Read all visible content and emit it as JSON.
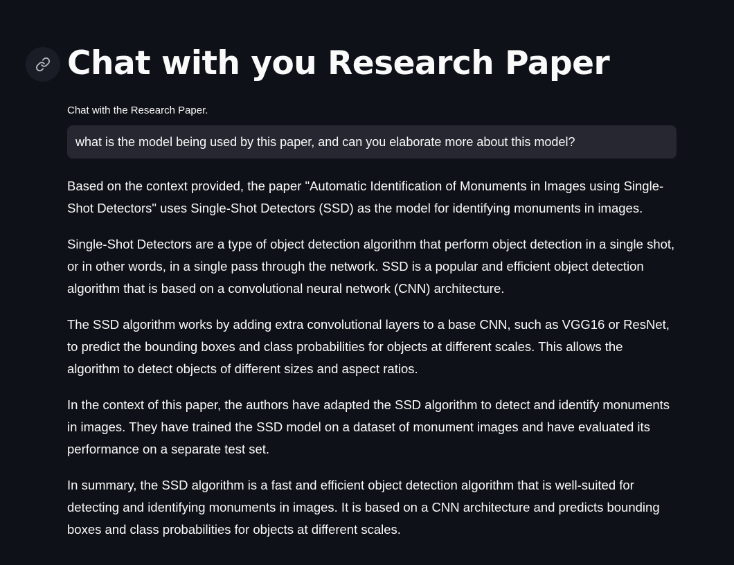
{
  "header": {
    "title": "Chat with you Research Paper",
    "anchor_icon": "link-icon"
  },
  "query": {
    "label": "Chat with the Research Paper.",
    "value": "what is the model being used by this paper, and can you elaborate more about this model?"
  },
  "answer": {
    "paragraphs": [
      "Based on the context provided, the paper \"Automatic Identification of Monuments in Images using Single-Shot Detectors\" uses Single-Shot Detectors (SSD) as the model for identifying monuments in images.",
      "Single-Shot Detectors are a type of object detection algorithm that perform object detection in a single shot, or in other words, in a single pass through the network. SSD is a popular and efficient object detection algorithm that is based on a convolutional neural network (CNN) architecture.",
      "The SSD algorithm works by adding extra convolutional layers to a base CNN, such as VGG16 or ResNet, to predict the bounding boxes and class probabilities for objects at different scales. This allows the algorithm to detect objects of different sizes and aspect ratios.",
      "In the context of this paper, the authors have adapted the SSD algorithm to detect and identify monuments in images. They have trained the SSD model on a dataset of monument images and have evaluated its performance on a separate test set.",
      "In summary, the SSD algorithm is a fast and efficient object detection algorithm that is well-suited for detecting and identifying monuments in images. It is based on a CNN architecture and predicts bounding boxes and class probabilities for objects at different scales."
    ]
  },
  "colors": {
    "background": "#0e1117",
    "text": "#fafafa",
    "input_background": "#262730"
  }
}
